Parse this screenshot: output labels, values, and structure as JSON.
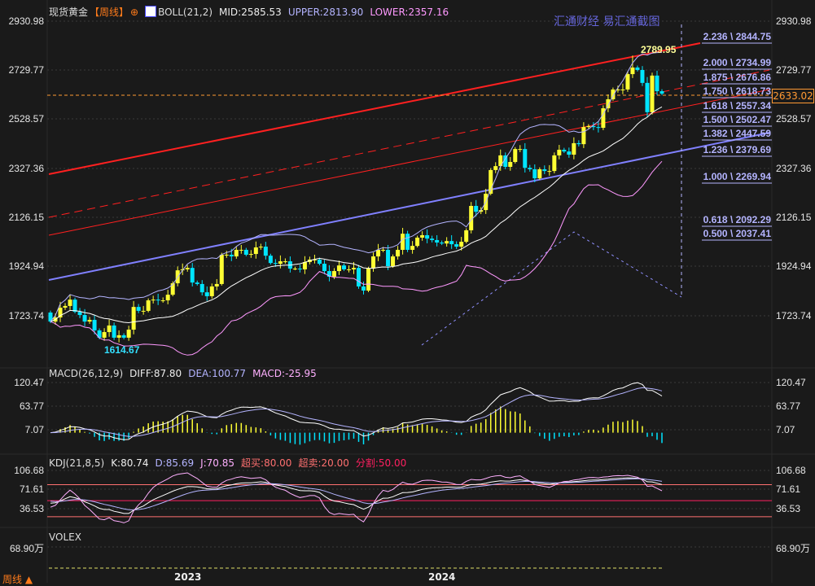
{
  "header": {
    "symbol": "现货黄金",
    "period": "【周线】",
    "indicator_icon": "boll-chart-icon",
    "boll_label": "BOLL(21,2)",
    "mid": "MID:2585.53",
    "upper": "UPPER:2813.90",
    "lower": "LOWER:2357.16"
  },
  "watermark": "汇通财经 易汇通截图",
  "price_axis": [
    "2930.98",
    "2729.77",
    "2528.57",
    "2327.36",
    "2126.15",
    "1924.94",
    "1723.74"
  ],
  "current_price": "2633.02",
  "annotations": {
    "high": "2789.95",
    "low": "1614.67"
  },
  "fib_levels": [
    "2.236 \\ 2844.75",
    "2.000 \\ 2734.99",
    "1.875 \\ 2676.86",
    "1.750 \\ 2618.73",
    "1.618 \\ 2557.34",
    "1.500 \\ 2502.47",
    "1.382 \\ 2447.59",
    "1.236 \\ 2379.69",
    "1.000 \\ 2269.94",
    "0.618 \\ 2092.29",
    "0.500 \\ 2037.41"
  ],
  "macd": {
    "label": "MACD(26,12,9)",
    "diff": "DIFF:87.80",
    "dea": "DEA:100.77",
    "macd": "MACD:-25.95",
    "axis": [
      "120.47",
      "63.77",
      "7.07"
    ]
  },
  "kdj": {
    "label": "KDJ(21,8,5)",
    "k": "K:80.74",
    "d": "D:85.69",
    "j": "J:70.85",
    "overbought": "超买:80.00",
    "oversold": "超卖:20.00",
    "split": "分割:50.00",
    "axis": [
      "106.68",
      "71.61",
      "36.53"
    ]
  },
  "volex": {
    "label": "VOLEX",
    "axis": "68.90万"
  },
  "dates": [
    "2023",
    "2024"
  ],
  "period_button": "周线",
  "colors": {
    "up": "#ffff33",
    "down": "#00e5ff",
    "boll_mid": "#ffffff",
    "boll_upper": "#b4b4ff",
    "boll_lower": "#ff99ff",
    "channel": "#ff2020",
    "trend": "#8080ff"
  },
  "chart_data": {
    "type": "candlestick",
    "title": "现货黄金 周线",
    "first_open": 1737,
    "closes": [
      1700,
      1717,
      1757,
      1764,
      1790,
      1740,
      1727,
      1700,
      1707,
      1664,
      1634,
      1657,
      1684,
      1634,
      1644,
      1634,
      1667,
      1760,
      1744,
      1744,
      1787,
      1790,
      1787,
      1787,
      1810,
      1857,
      1910,
      1914,
      1920,
      1860,
      1854,
      1820,
      1804,
      1844,
      1854,
      1974,
      1974,
      1967,
      1994,
      1994,
      1974,
      1977,
      2004,
      2007,
      1970,
      1940,
      1937,
      1947,
      1947,
      1917,
      1917,
      1914,
      1944,
      1954,
      1954,
      1937,
      1907,
      1884,
      1907,
      1930,
      1914,
      1914,
      1920,
      1844,
      1827,
      1917,
      1967,
      1994,
      1994,
      1927,
      1967,
      1994,
      2060,
      1994,
      2010,
      2044,
      2054,
      2040,
      2034,
      2024,
      2020,
      2030,
      2017,
      2007,
      2027,
      2074,
      2174,
      2150,
      2157,
      2224,
      2321,
      2337,
      2381,
      2334,
      2354,
      2407,
      2407,
      2330,
      2324,
      2287,
      2324,
      2317,
      2317,
      2381,
      2404,
      2397,
      2384,
      2431,
      2427,
      2497,
      2501,
      2497,
      2494,
      2574,
      2611,
      2651,
      2651,
      2651,
      2714,
      2741,
      2731,
      2678,
      2558,
      2708,
      2644,
      2634
    ],
    "ylim": [
      1614,
      2931
    ]
  }
}
